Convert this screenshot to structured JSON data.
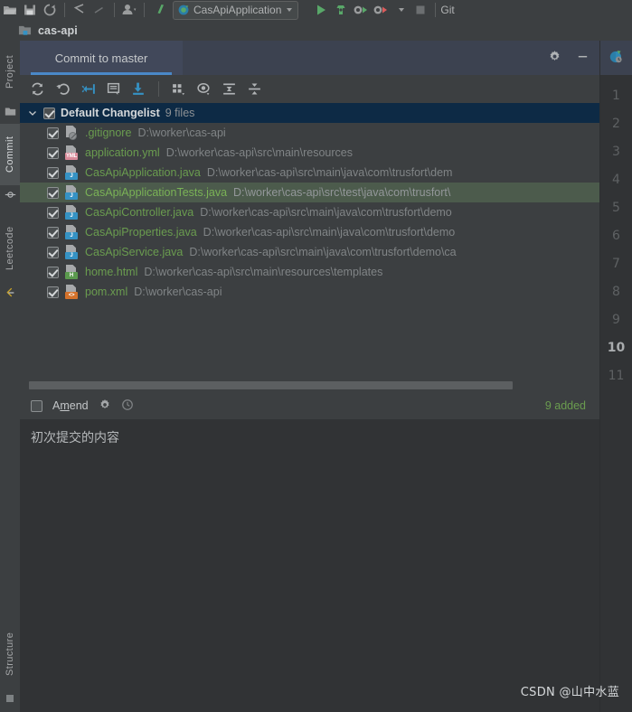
{
  "main_toolbar": {
    "icons": [
      "open-folder-icon",
      "save-all-icon",
      "sync-icon",
      "undo-icon",
      "redo-icon",
      "profile-icon",
      "git-branch-icon"
    ],
    "run_configuration": "CasApiApplication",
    "run_icons": [
      "run-icon",
      "build-icon",
      "debug-icon",
      "coverage-icon",
      "more-run-icon",
      "stop-icon"
    ],
    "right_truncated_label": "Git"
  },
  "project_bar": {
    "project_name": "cas-api",
    "icon": "module-folder-icon"
  },
  "left_stripe": {
    "items": [
      {
        "label": "Project",
        "icon": "project-folder-icon",
        "active": false
      },
      {
        "label": "Commit",
        "icon": "commit-node-icon",
        "active": true
      },
      {
        "label": "Leetcode",
        "icon": "leetcode-icon",
        "active": false
      },
      {
        "label": "Structure",
        "icon": "structure-icon",
        "active": false
      }
    ]
  },
  "commit_tool_window": {
    "tab_label": "Commit to master",
    "header_icons": [
      "gear-icon",
      "minimize-icon"
    ],
    "toolbar_icons": [
      "refresh-icon",
      "rollback-icon",
      "shelve-silently-icon",
      "show-diff-icon",
      "update-project-icon",
      "group-by-icon",
      "preview-diff-icon",
      "expand-all-icon",
      "collapse-all-icon"
    ],
    "changelist": {
      "name": "Default Changelist",
      "count_label": "9 files",
      "checked": true,
      "expanded": true
    },
    "files": [
      {
        "name": ".gitignore",
        "path": "D:\\worker\\cas-api",
        "icon": "ignored-file-icon",
        "badge": "",
        "badge_color": "",
        "checked": true,
        "selected": false
      },
      {
        "name": "application.yml",
        "path": "D:\\worker\\cas-api\\src\\main\\resources",
        "icon": "yml-file-icon",
        "badge": "YML",
        "badge_color": "#d98b9a",
        "checked": true,
        "selected": false
      },
      {
        "name": "CasApiApplication.java",
        "path": "D:\\worker\\cas-api\\src\\main\\java\\com\\trusfort\\dem",
        "icon": "java-file-icon",
        "badge": "J",
        "badge_color": "#3592c4",
        "checked": true,
        "selected": false
      },
      {
        "name": "CasApiApplicationTests.java",
        "path": "D:\\worker\\cas-api\\src\\test\\java\\com\\trusfort\\",
        "icon": "java-file-icon",
        "badge": "J",
        "badge_color": "#3592c4",
        "checked": true,
        "selected": true
      },
      {
        "name": "CasApiController.java",
        "path": "D:\\worker\\cas-api\\src\\main\\java\\com\\trusfort\\demo",
        "icon": "java-file-icon",
        "badge": "J",
        "badge_color": "#3592c4",
        "checked": true,
        "selected": false
      },
      {
        "name": "CasApiProperties.java",
        "path": "D:\\worker\\cas-api\\src\\main\\java\\com\\trusfort\\demo",
        "icon": "java-file-icon",
        "badge": "J",
        "badge_color": "#3592c4",
        "checked": true,
        "selected": false
      },
      {
        "name": "CasApiService.java",
        "path": "D:\\worker\\cas-api\\src\\main\\java\\com\\trusfort\\demo\\ca",
        "icon": "java-file-icon",
        "badge": "J",
        "badge_color": "#3592c4",
        "checked": true,
        "selected": false
      },
      {
        "name": "home.html",
        "path": "D:\\worker\\cas-api\\src\\main\\resources\\templates",
        "icon": "html-file-icon",
        "badge": "H",
        "badge_color": "#5b9a4e",
        "checked": true,
        "selected": false
      },
      {
        "name": "pom.xml",
        "path": "D:\\worker\\cas-api",
        "icon": "xml-file-icon",
        "badge": "<>",
        "badge_color": "#d4722b",
        "checked": true,
        "selected": false
      }
    ],
    "amend": {
      "label_prefix": "A",
      "label_accel": "m",
      "label_suffix": "end",
      "checked": false,
      "icons": [
        "gear-icon",
        "history-icon"
      ]
    },
    "added_count": "9 added",
    "commit_message": "初次提交的内容"
  },
  "right_gutter": {
    "top_icon": "coverage-run-icon",
    "line_numbers": [
      "1",
      "2",
      "3",
      "4",
      "5",
      "6",
      "7",
      "8",
      "9",
      "10",
      "11"
    ],
    "current_line": "10"
  },
  "watermark": "CSDN @山中水蓝",
  "colors": {
    "background": "#3c3f41",
    "editor_background": "#313335",
    "tab_active": "#41485a",
    "tab_underline": "#4a88c7",
    "changelist_row": "#0d2a45",
    "selected_row": "#4c5b4c",
    "added_green": "#6a9c4f",
    "path_gray": "#808486"
  }
}
